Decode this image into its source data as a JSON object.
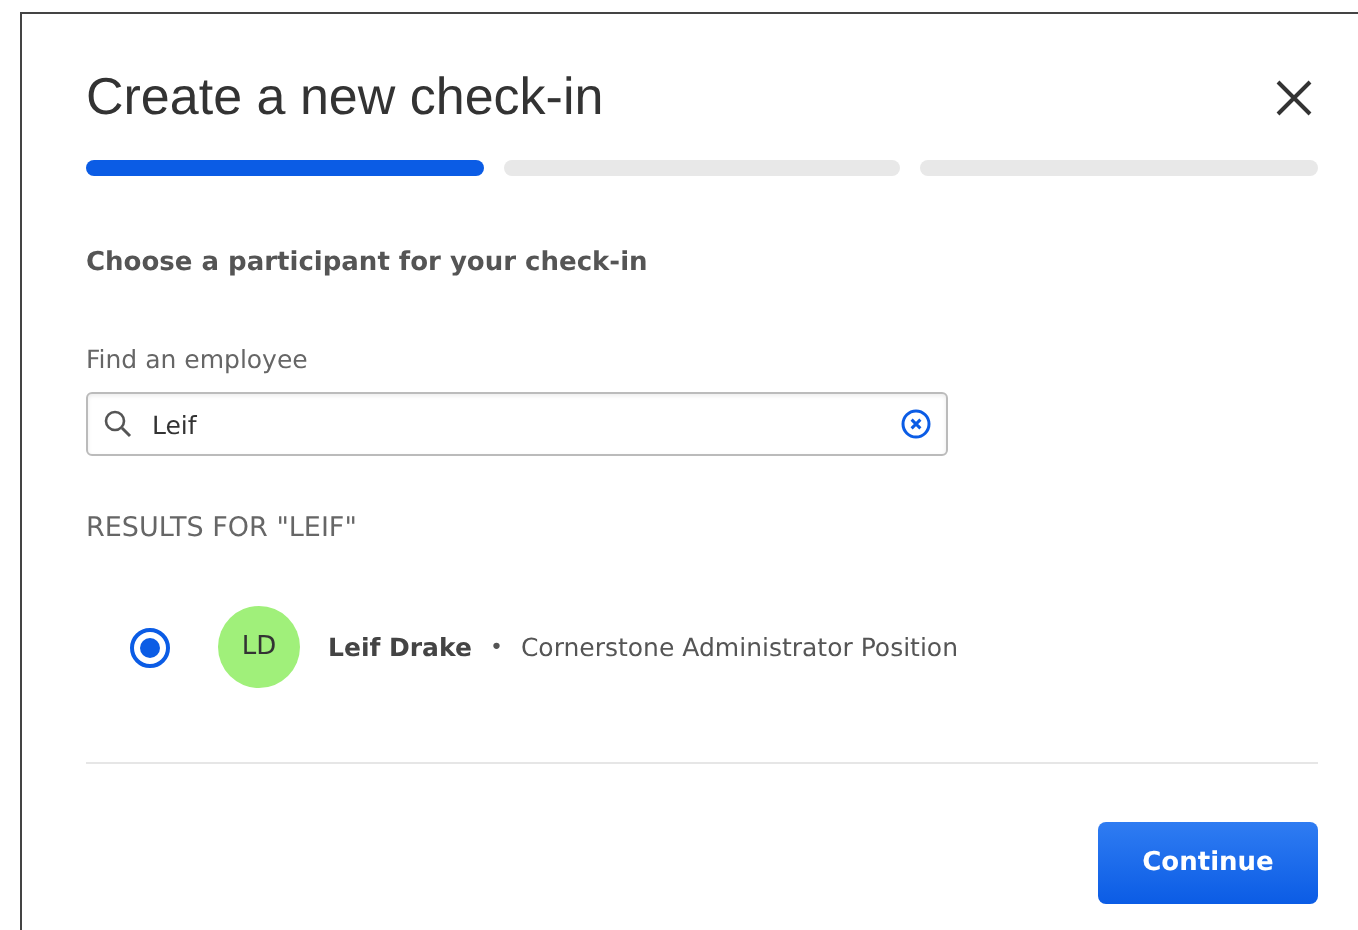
{
  "dialog": {
    "title": "Create a new check-in"
  },
  "steps": [
    {
      "selected": true
    },
    {
      "selected": false
    },
    {
      "selected": false
    }
  ],
  "prompt": "Choose a participant for your check-in",
  "search": {
    "label": "Find an employee",
    "value": "Leif"
  },
  "results_heading": "RESULTS FOR \"LEIF\"",
  "results": [
    {
      "initials": "LD",
      "color": "#a0f07a",
      "name": "Leif Drake",
      "separator": "•",
      "position": "Cornerstone Administrator Position",
      "selected": true
    }
  ],
  "buttons": [
    {
      "label": "Continue"
    }
  ]
}
